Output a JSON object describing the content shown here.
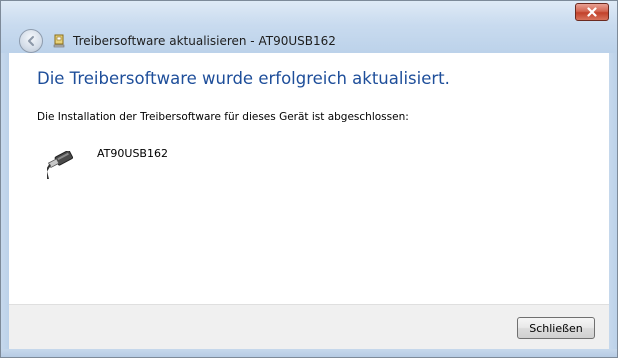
{
  "window": {
    "title": "Treibersoftware aktualisieren - AT90USB162",
    "title_color": "#1e1e1e"
  },
  "icons": {
    "back": "back-arrow-icon",
    "wizard": "device-manager-icon",
    "close": "close-icon",
    "device": "usb-plug-icon"
  },
  "main": {
    "headline": "Die Treibersoftware wurde erfolgreich aktualisiert.",
    "headline_color": "#1e4e9a",
    "description": "Die Installation der Treibersoftware für dieses Gerät ist abgeschlossen:",
    "device_name": "AT90USB162"
  },
  "footer": {
    "close_label": "Schließen"
  }
}
